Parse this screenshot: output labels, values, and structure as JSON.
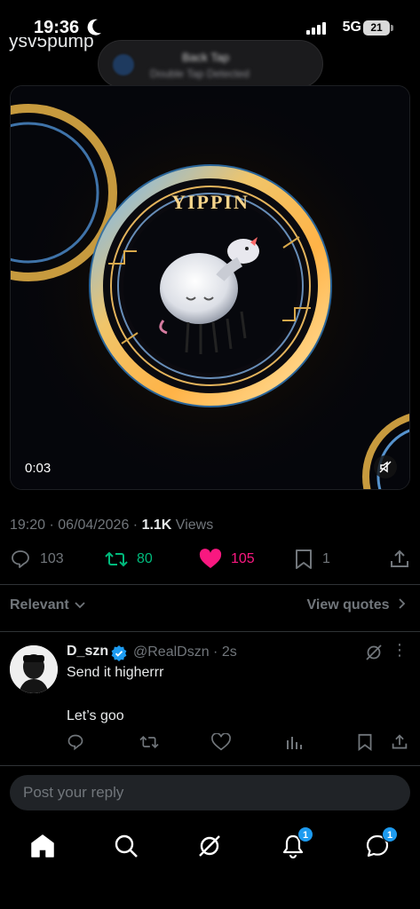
{
  "status_bar": {
    "time": "19:36",
    "network": "5G",
    "battery": "21"
  },
  "cutoff_username": "ysv5pump",
  "notification": {
    "title": "Back Tap",
    "subtitle": "Double Tap Detected"
  },
  "media": {
    "art_text": "YIPPIN",
    "duration": "0:03"
  },
  "post_meta": {
    "time": "19:20",
    "sep1": " · ",
    "date": "06/04/2026",
    "sep2": " · ",
    "views_count": "1.1K",
    "views_label": " Views"
  },
  "actions": {
    "replies": "103",
    "reposts": "80",
    "likes": "105",
    "bookmarks": "1"
  },
  "colors": {
    "repost_green": "#00ba7c",
    "like_pink": "#f91880",
    "accent_blue": "#1d9bf0"
  },
  "sort": {
    "label": "Relevant",
    "view_quotes": "View quotes"
  },
  "reply": {
    "name": "D_szn",
    "handle": "@RealDszn",
    "time": "2s",
    "sep": " · ",
    "line1": "Send it higherrr",
    "line2": "Let’s goo"
  },
  "reply_box": {
    "placeholder": "Post your reply"
  },
  "bottom_nav": {
    "notifications_badge": "1",
    "messages_badge": "1"
  },
  "icons": [
    "moon-icon",
    "signal-icon",
    "battery-icon",
    "mute-icon",
    "reply-icon",
    "repost-icon",
    "heart-icon",
    "bookmark-icon",
    "share-icon",
    "chevron-down-icon",
    "chevron-right-icon",
    "verified-icon",
    "grok-icon",
    "more-icon",
    "analytics-icon",
    "home-icon",
    "search-icon",
    "bell-icon",
    "messages-icon"
  ]
}
